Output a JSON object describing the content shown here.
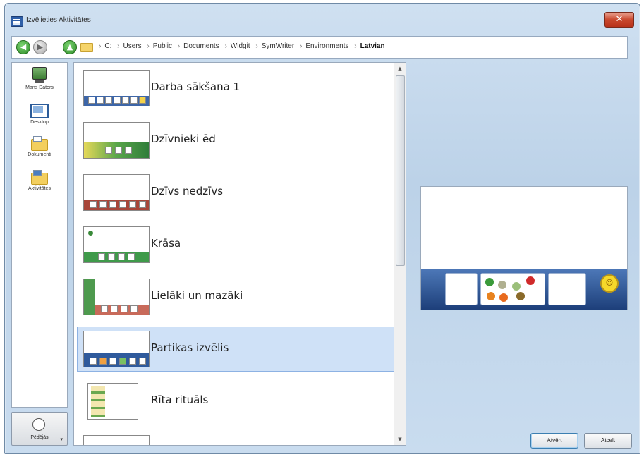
{
  "window": {
    "title": "Izvēlieties Aktivitātes",
    "close_label": "✕"
  },
  "address": {
    "crumbs": [
      "C:",
      "Users",
      "Public",
      "Documents",
      "Widgit",
      "SymWriter",
      "Environments"
    ],
    "current": "Latvian"
  },
  "places": [
    {
      "label": "Mans Dators",
      "icon": "computer-icon"
    },
    {
      "label": "Desktop",
      "icon": "desktop-icon"
    },
    {
      "label": "Dokumenti",
      "icon": "documents-folder-icon"
    },
    {
      "label": "Aktivitātes",
      "icon": "activities-folder-icon"
    }
  ],
  "history": {
    "label": "Pēdējās"
  },
  "files": [
    {
      "name": "Darba sākšana 1"
    },
    {
      "name": "Dzīvnieki ēd"
    },
    {
      "name": "Dzīvs nedzīvs"
    },
    {
      "name": "Krāsa"
    },
    {
      "name": "Lielāki un mazāki"
    },
    {
      "name": "Partikas izvēlis",
      "selected": true
    },
    {
      "name": "Rīta rituāls"
    }
  ],
  "preview": {
    "smiley": "☺"
  },
  "buttons": {
    "open": "Atvērt",
    "cancel": "Atcelt"
  }
}
